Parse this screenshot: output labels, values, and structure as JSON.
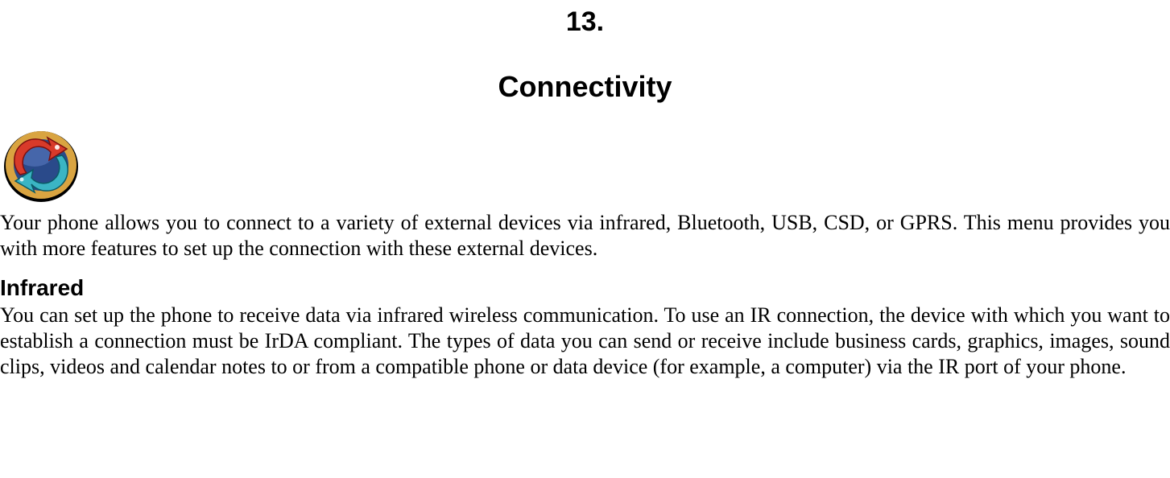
{
  "chapter": {
    "number": "13.",
    "title": "Connectivity"
  },
  "intro": "Your phone allows you to connect to a variety of external devices via infrared, Bluetooth, USB, CSD, or GPRS. This menu provides you with more features to set up the connection with these external devices.",
  "section": {
    "heading": "Infrared",
    "body": "You can set up the phone to receive data via infrared wireless communication. To use an IR connection, the device with which you want to establish a connection must be IrDA compliant. The types of data you can send or receive include business cards, graphics, images, sound clips, videos and calendar notes to or from a compatible phone or data device (for example, a computer) via the IR port of your phone."
  },
  "icon": {
    "name": "sync-arrows-icon"
  }
}
